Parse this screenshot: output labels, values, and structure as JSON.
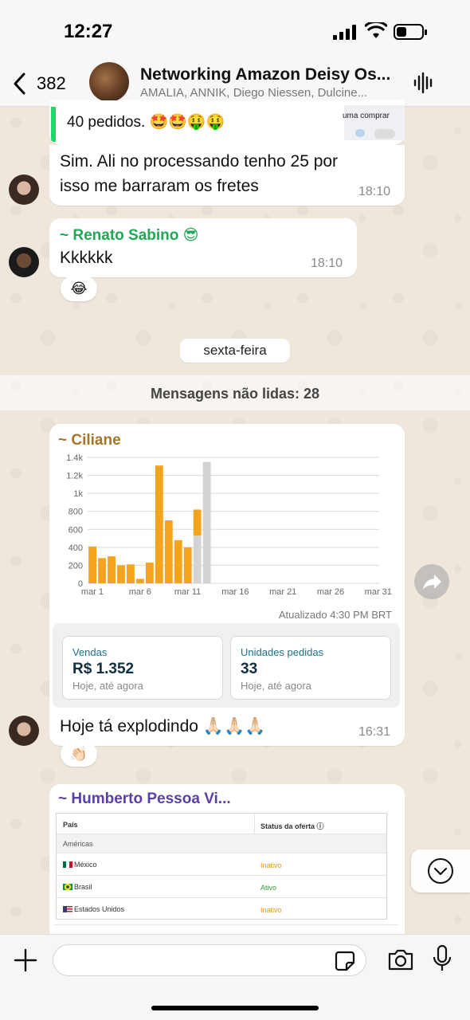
{
  "status_bar": {
    "time": "12:27"
  },
  "header": {
    "back_count": "382",
    "title": "Networking Amazon Deisy Os...",
    "members": "AMALIA, ANNIK, Diego Niessen, Dulcine..."
  },
  "messages": {
    "quoted_tail": "40 pedidos. 🤩🤩🤑🤑",
    "quoted_preview_right": "uma comprar",
    "m1": {
      "text_line1": "Sim. Ali no processando tenho 25 por",
      "text_line2": "isso me barraram os fretes",
      "time": "18:10"
    },
    "m2": {
      "sender": "~ Renato Sabino 😎",
      "text": "Kkkkkk",
      "time": "18:10",
      "reaction": "😂"
    },
    "day_separator": "sexta-feira",
    "unread": "Mensagens não lidas: 28",
    "m3": {
      "sender": "~ Ciliane",
      "updated": "Atualizado 4:30 PM BRT",
      "metrics": [
        {
          "label": "Vendas",
          "value": "R$ 1.352",
          "sub": "Hoje, até agora"
        },
        {
          "label": "Unidades pedidas",
          "value": "33",
          "sub": "Hoje, até agora"
        }
      ],
      "caption": "Hoje tá explodindo 🙏🏻🙏🏻🙏🏻",
      "time": "16:31",
      "reaction": "👏🏻"
    },
    "m4": {
      "sender": "~ Humberto  Pessoa  Vi...",
      "table": {
        "headers": [
          "País",
          "Status da oferta ⓘ"
        ],
        "region": "Américas",
        "rows": [
          {
            "country": "México",
            "status": "Inativo",
            "status_color": "#e0952a"
          },
          {
            "country": "Brasil",
            "status": "Ativo",
            "status_color": "#3a9a3a"
          },
          {
            "country": "Estados Unidos",
            "status": "Inativo",
            "status_color": "#e0952a"
          }
        ]
      }
    }
  },
  "chart_data": {
    "type": "bar",
    "categories": [
      "mar 1",
      "mar 2",
      "mar 3",
      "mar 4",
      "mar 5",
      "mar 6",
      "mar 7",
      "mar 8",
      "mar 9",
      "mar 10",
      "mar 11",
      "mar 12",
      "mar 13"
    ],
    "values": [
      410,
      280,
      300,
      200,
      210,
      50,
      230,
      1310,
      700,
      480,
      400,
      820,
      1350
    ],
    "partial_values": [
      0,
      0,
      0,
      0,
      0,
      0,
      0,
      0,
      0,
      0,
      0,
      530,
      1350
    ],
    "xticks": [
      "mar 1",
      "mar 6",
      "mar 11",
      "mar 16",
      "mar 21",
      "mar 26",
      "mar 31"
    ],
    "yticks": [
      "0",
      "200",
      "400",
      "600",
      "800",
      "1k",
      "1.2k",
      "1.4k"
    ],
    "ylim": [
      0,
      1400
    ],
    "xrange_days": [
      1,
      31
    ],
    "colors": {
      "bar": "#f4a31c",
      "current": "#d3d3d3",
      "grid": "#d9d9d9"
    }
  },
  "input": {
    "placeholder": ""
  },
  "colors": {
    "accent_green": "#25d366",
    "renato": "#1fa855",
    "ciliane": "#a8742b",
    "humberto": "#5b3fa6"
  }
}
